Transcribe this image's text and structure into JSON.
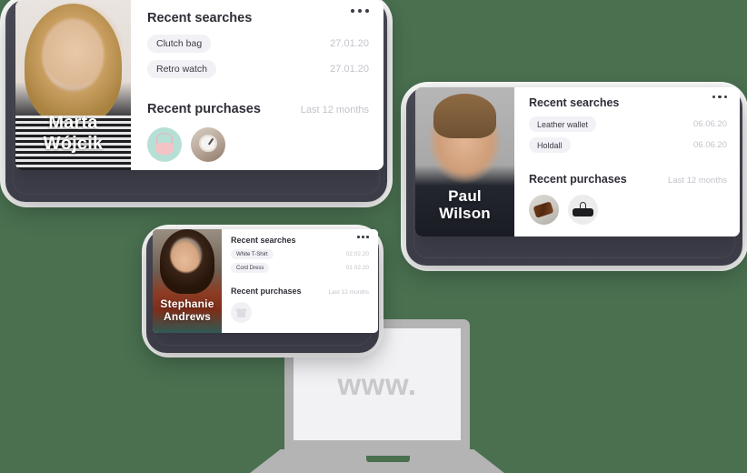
{
  "background_color": "#4a7050",
  "device_frame_color": "#464653",
  "labels": {
    "recent_searches": "Recent searches",
    "recent_purchases": "Recent purchases",
    "last_12_months": "Last 12 months",
    "menu_icon": "more-options-icon"
  },
  "cards": [
    {
      "id": "marta",
      "person_name_line1": "Marta",
      "person_name_line2": "Wójcik",
      "searches_title": "Recent searches",
      "purchases_title": "Recent purchases",
      "purchases_period": "Last 12 months",
      "searches": [
        {
          "label": "Clutch bag",
          "date": "27.01.20"
        },
        {
          "label": "Retro watch",
          "date": "27.01.20"
        }
      ],
      "purchases": [
        {
          "name": "clutch-bag-thumbnail"
        },
        {
          "name": "retro-watch-thumbnail"
        }
      ]
    },
    {
      "id": "paul",
      "person_name_line1": "Paul",
      "person_name_line2": "Wilson",
      "searches_title": "Recent searches",
      "purchases_title": "Recent purchases",
      "purchases_period": "Last 12 months",
      "searches": [
        {
          "label": "Leather wallet",
          "date": "06.06.20"
        },
        {
          "label": "Holdall",
          "date": "06.06.20"
        }
      ],
      "purchases": [
        {
          "name": "leather-wallet-thumbnail"
        },
        {
          "name": "holdall-thumbnail"
        }
      ]
    },
    {
      "id": "stephanie",
      "person_name_line1": "Stephanie",
      "person_name_line2": "Andrews",
      "searches_title": "Recent searches",
      "purchases_title": "Recent purchases",
      "purchases_period": "Last 12 months",
      "searches": [
        {
          "label": "White T-Shirt",
          "date": "02.02.20"
        },
        {
          "label": "Cord Dress",
          "date": "01.02.20"
        }
      ],
      "purchases": [
        {
          "name": "white-tshirt-thumbnail"
        }
      ]
    }
  ],
  "laptop": {
    "screen_text": "www.",
    "body_color": "#b4b4b4",
    "screen_color": "#f2f2f5"
  }
}
